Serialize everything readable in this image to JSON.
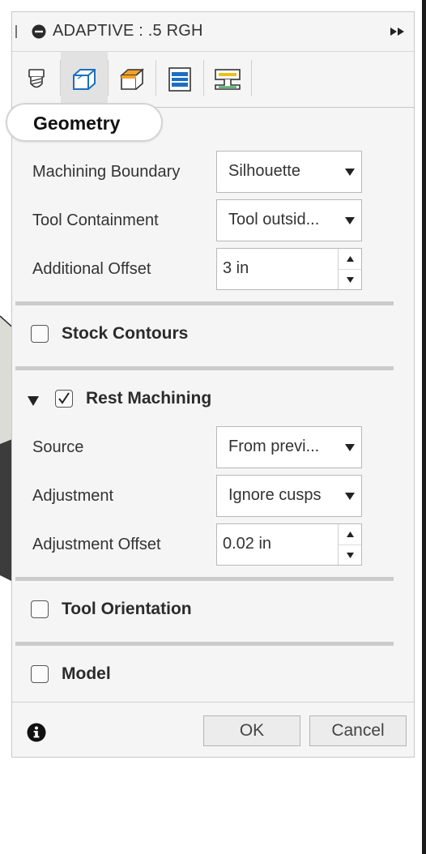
{
  "dialog": {
    "title": "ADAPTIVE : .5 RGH"
  },
  "tabs": [
    {
      "icon": "tool-icon"
    },
    {
      "icon": "geometry-icon"
    },
    {
      "icon": "heights-icon"
    },
    {
      "icon": "passes-icon"
    },
    {
      "icon": "linking-icon"
    }
  ],
  "geometry": {
    "section_title": "Geometry",
    "machining_boundary_label": "Machining Boundary",
    "machining_boundary_value": "Silhouette",
    "tool_containment_label": "Tool Containment",
    "tool_containment_value": "Tool outsid...",
    "additional_offset_label": "Additional Offset",
    "additional_offset_value": "3 in"
  },
  "stock_contours": {
    "label": "Stock Contours",
    "checked": false
  },
  "rest_machining": {
    "label": "Rest Machining",
    "checked": true,
    "source_label": "Source",
    "source_value": "From previ...",
    "adjustment_label": "Adjustment",
    "adjustment_value": "Ignore cusps",
    "adjustment_offset_label": "Adjustment Offset",
    "adjustment_offset_value": "0.02 in"
  },
  "tool_orientation": {
    "label": "Tool Orientation",
    "checked": false
  },
  "model": {
    "label": "Model",
    "checked": false
  },
  "footer": {
    "ok_label": "OK",
    "cancel_label": "Cancel"
  },
  "colors": {
    "panel_bg": "#f5f5f5",
    "active_tab_bg": "#e2e2e2",
    "divider": "#cbcbcb"
  }
}
